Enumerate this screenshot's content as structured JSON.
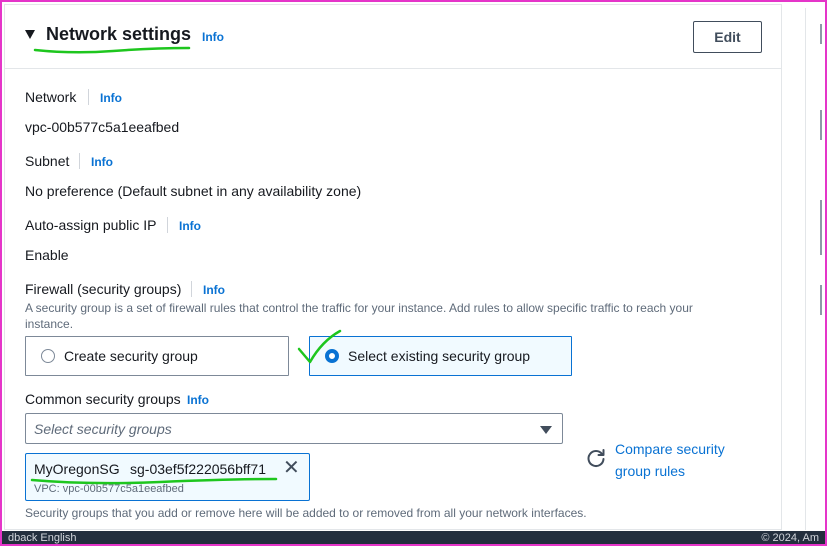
{
  "panel": {
    "title": "Network settings",
    "title_info": "Info",
    "edit_label": "Edit"
  },
  "fields": {
    "network_label": "Network",
    "network_info": "Info",
    "network_value": "vpc-00b577c5a1eeafbed",
    "subnet_label": "Subnet",
    "subnet_info": "Info",
    "subnet_value": "No preference (Default subnet in any availability zone)",
    "public_ip_label": "Auto-assign public IP",
    "public_ip_info": "Info",
    "public_ip_value": "Enable",
    "firewall_label": "Firewall (security groups)",
    "firewall_info": "Info",
    "firewall_desc": "A security group is a set of firewall rules that control the traffic for your instance. Add rules to allow specific traffic to reach your instance."
  },
  "firewall_options": {
    "create_label": "Create security group",
    "existing_label": "Select existing security group",
    "selected": "existing"
  },
  "common_sg": {
    "label": "Common security groups",
    "info": "Info",
    "placeholder": "Select security groups",
    "compare_link": "Compare security group rules",
    "selected_token": {
      "name": "MyOregonSG",
      "id": "sg-03ef5f222056bff71",
      "vpc": "VPC: vpc-00b577c5a1eeafbed"
    },
    "footnote": "Security groups that you add or remove here will be added to or removed from all your network interfaces."
  },
  "footer": {
    "left": "dback  English",
    "right": "© 2024, Am"
  },
  "colors": {
    "link": "#0972d3",
    "annotation": "#1ec61e",
    "frame": "#e535c9",
    "footer_bg": "#232f3e"
  },
  "icons": {
    "caret": "caret-down-icon",
    "dropdown": "dropdown-arrow-icon",
    "remove": "close-icon",
    "compare": "refresh-icon"
  }
}
